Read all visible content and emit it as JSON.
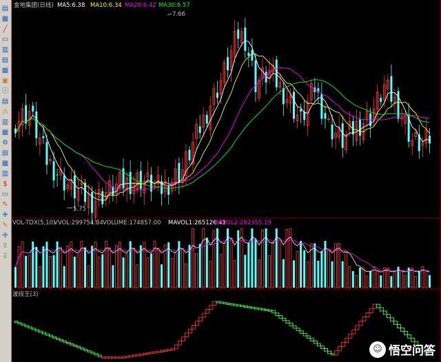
{
  "toolbar": {
    "icons": [
      "chart-icon",
      "grid-icon",
      "line-icon",
      "ruler-icon",
      "table-icon",
      "list-icon",
      "calendar-icon",
      "folder-icon",
      "info-icon",
      "news-icon",
      "warning-icon",
      "report-icon",
      "stats-icon",
      "settings-icon",
      "compare-icon",
      "search-icon",
      "filter-icon",
      "dollar-icon",
      "zoom-icon",
      "flag-icon",
      "export-icon",
      "pencil-icon",
      "move-icon",
      "up-arrow-icon",
      "down-arrow-icon"
    ]
  },
  "price_panel": {
    "header": {
      "stock_name": "金地集团(日线)",
      "ma5": "MA5:6.38",
      "ma10": "MA10:6.34",
      "ma20": "MA20:6.42",
      "ma30": "MA30:6.57"
    },
    "high_label": "7.66",
    "low_label": "5.75",
    "colors": {
      "up": "#ff3c3c",
      "down": "#54ffff",
      "ma5": "#ffffff",
      "ma10": "#ffff00",
      "ma20": "#ff00ff",
      "ma30": "#00ff00"
    }
  },
  "volume_panel": {
    "header": {
      "indicator": "VOL-TDX(5,10)",
      "vvol": "VVOL:299754.84",
      "volume": "VOLUME:174857.00",
      "mavol1": "MAVOL1:265126.41",
      "mavol2": "MAVOL2:282355.19"
    }
  },
  "wave_panel": {
    "header": {
      "indicator": "波段王(3)"
    },
    "colors": {
      "up": "#ff3030",
      "down": "#40ff40"
    }
  },
  "watermark": {
    "text": "悟空问答",
    "logo_glyph": "☺"
  }
}
